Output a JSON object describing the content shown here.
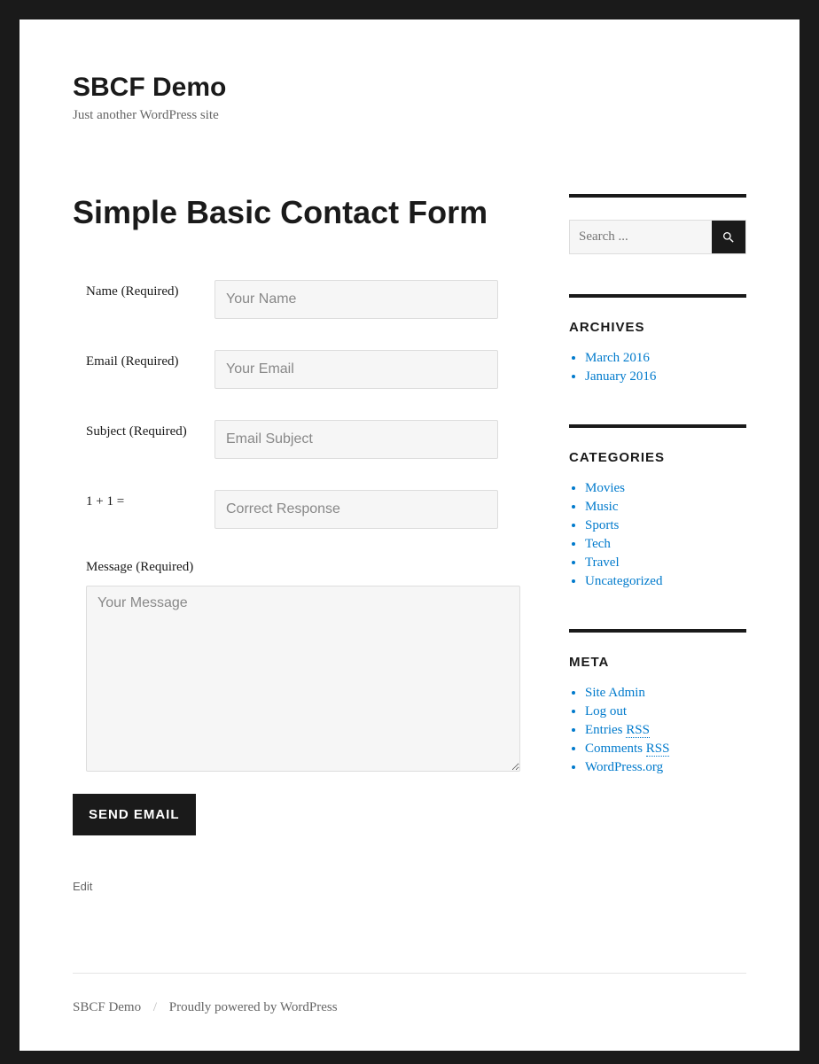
{
  "site": {
    "title": "SBCF Demo",
    "tagline": "Just another WordPress site"
  },
  "page": {
    "title": "Simple Basic Contact Form",
    "edit_label": "Edit"
  },
  "form": {
    "name_label": "Name (Required)",
    "name_placeholder": "Your Name",
    "email_label": "Email (Required)",
    "email_placeholder": "Your Email",
    "subject_label": "Subject (Required)",
    "subject_placeholder": "Email Subject",
    "captcha_label": "1 + 1 =",
    "captcha_placeholder": "Correct Response",
    "message_label": "Message (Required)",
    "message_placeholder": "Your Message",
    "submit_label": "Send Email"
  },
  "sidebar": {
    "search_placeholder": "Search ...",
    "archives": {
      "title": "ARCHIVES",
      "items": [
        "March 2016",
        "January 2016"
      ]
    },
    "categories": {
      "title": "CATEGORIES",
      "items": [
        "Movies",
        "Music",
        "Sports",
        "Tech",
        "Travel",
        "Uncategorized"
      ]
    },
    "meta": {
      "title": "META",
      "items": [
        {
          "label": "Site Admin"
        },
        {
          "label": "Log out"
        },
        {
          "label": "Entries ",
          "rss": "RSS"
        },
        {
          "label": "Comments ",
          "rss": "RSS"
        },
        {
          "label": "WordPress.org"
        }
      ]
    }
  },
  "footer": {
    "site_link": "SBCF Demo",
    "sep": "/",
    "credit": "Proudly powered by WordPress"
  }
}
